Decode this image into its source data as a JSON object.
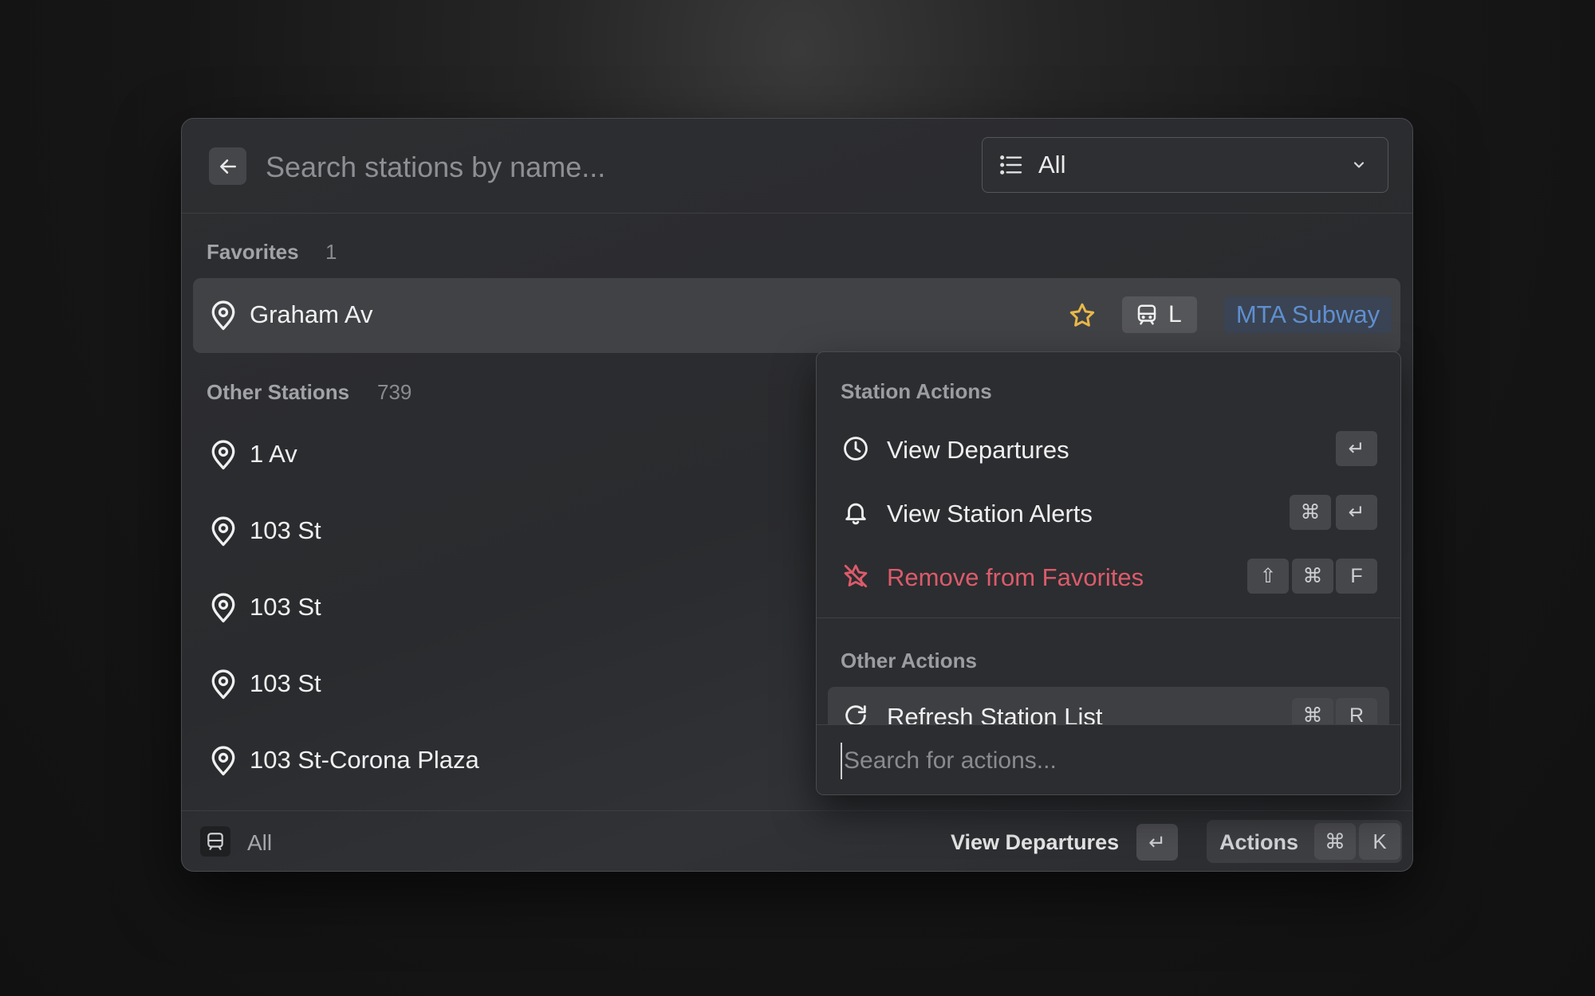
{
  "search": {
    "placeholder": "Search stations by name..."
  },
  "filter": {
    "value": "All"
  },
  "favorites": {
    "label": "Favorites",
    "count": "1",
    "items": [
      {
        "name": "Graham Av",
        "line": "L",
        "agency": "MTA Subway"
      }
    ]
  },
  "other": {
    "label": "Other Stations",
    "count": "739",
    "items": [
      {
        "name": "1 Av"
      },
      {
        "name": "103 St"
      },
      {
        "name": "103 St"
      },
      {
        "name": "103 St"
      },
      {
        "name": "103 St-Corona Plaza"
      }
    ]
  },
  "actions_panel": {
    "station_section": "Station Actions",
    "station_actions": [
      {
        "label": "View Departures",
        "keys": [
          "↵"
        ]
      },
      {
        "label": "View Station Alerts",
        "keys": [
          "⌘",
          "↵"
        ]
      },
      {
        "label": "Remove from Favorites",
        "keys": [
          "⇧",
          "⌘",
          "F"
        ]
      }
    ],
    "other_section": "Other Actions",
    "other_actions": [
      {
        "label": "Refresh Station List",
        "keys": [
          "⌘",
          "R"
        ]
      }
    ],
    "search_placeholder": "Search for actions..."
  },
  "footer": {
    "kind_label": "All",
    "primary_action": "View Departures",
    "primary_key": "↵",
    "actions_label": "Actions",
    "actions_keys": [
      "⌘",
      "K"
    ]
  },
  "colors": {
    "danger": "#dc5b6b",
    "star": "#e8b84a",
    "agency_text": "#5f8fcf"
  }
}
